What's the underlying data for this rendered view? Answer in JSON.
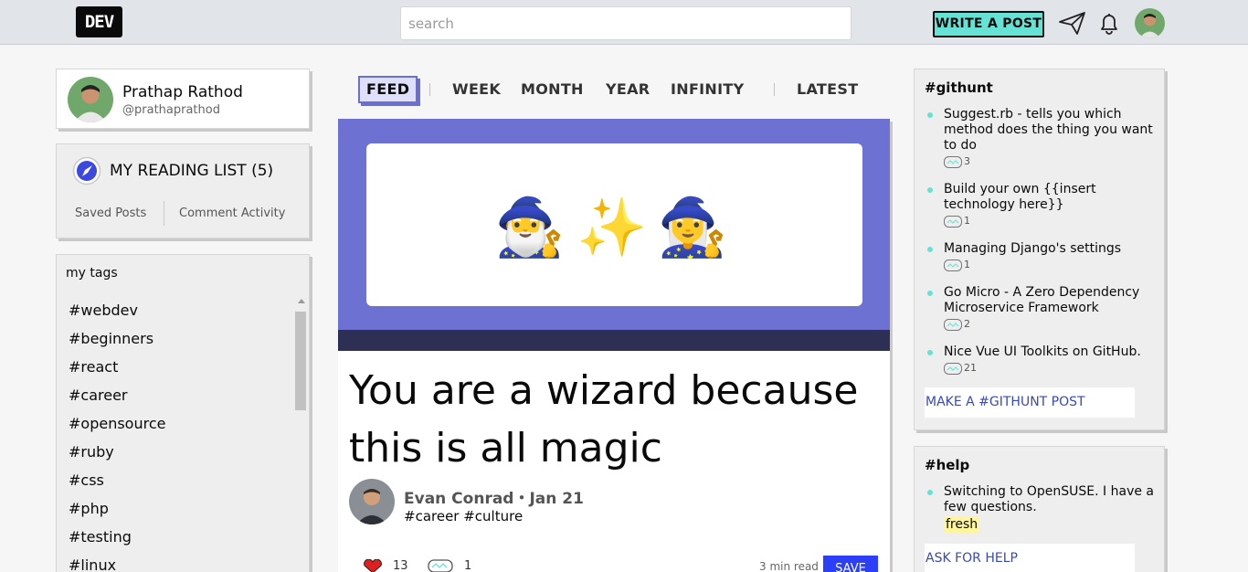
{
  "header": {
    "logo": "DEV",
    "search_placeholder": "search",
    "write_post": "WRITE A POST",
    "icons": [
      "send-icon",
      "bell-icon",
      "avatar"
    ]
  },
  "profile": {
    "name": "Prathap Rathod",
    "handle": "@prathaprathod"
  },
  "reading_list": {
    "title": "MY READING LIST (5)",
    "saved_posts": "Saved Posts",
    "comment_activity": "Comment Activity"
  },
  "tags": {
    "title": "my tags",
    "items": [
      "#webdev",
      "#beginners",
      "#react",
      "#career",
      "#opensource",
      "#ruby",
      "#css",
      "#php",
      "#testing",
      "#linux"
    ]
  },
  "feed_tabs": {
    "feed": "FEED",
    "week": "WEEK",
    "month": "MONTH",
    "year": "YEAR",
    "infinity": "INFINITY",
    "latest": "LATEST"
  },
  "article": {
    "emoji_1": "🧙‍♂️",
    "emoji_2": "✨",
    "emoji_3": "🧙‍♀️",
    "title": "You are a wizard because this is all magic",
    "author_line": "Evan Conrad・Jan 21",
    "tags": "#career #culture",
    "reactions": "13",
    "comments": "1",
    "read_time": "3 min read",
    "save": "SAVE"
  },
  "githunt": {
    "title": "#githunt",
    "items": [
      {
        "text": "Suggest.rb - tells you which method does the thing you want to do",
        "count": "3"
      },
      {
        "text": "Build your own {{insert technology here}}",
        "count": "1"
      },
      {
        "text": "Managing Django's settings",
        "count": "1"
      },
      {
        "text": "Go Micro - A Zero Dependency Microservice Framework",
        "count": "2"
      },
      {
        "text": "Nice Vue UI Toolkits on GitHub.",
        "count": "21"
      }
    ],
    "cta": "MAKE A #GITHUNT POST"
  },
  "help": {
    "title": "#help",
    "item": "Switching to OpenSUSE. I have a few questions.",
    "badge": "fresh",
    "cta": "ASK FOR HELP"
  },
  "colors": {
    "accent_teal": "#66e2d5",
    "cover_purple": "#6d71d1",
    "save_blue": "#2c3ff6"
  }
}
